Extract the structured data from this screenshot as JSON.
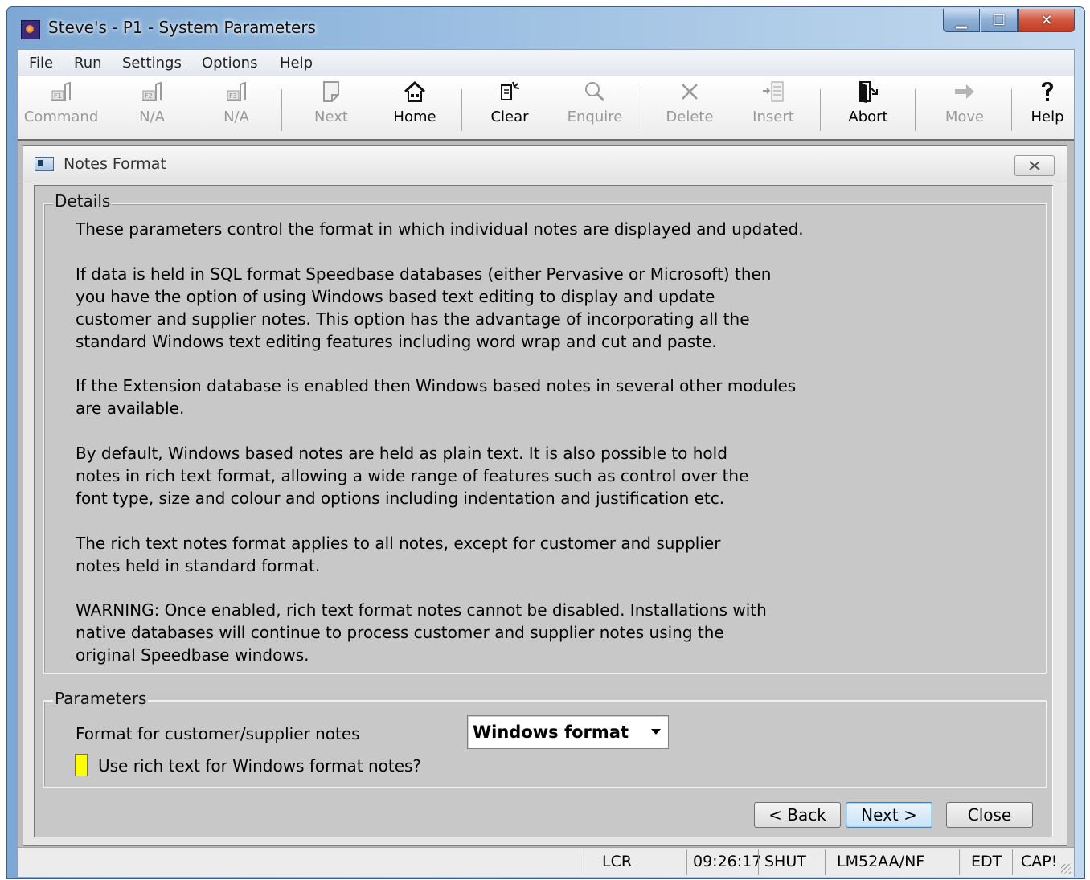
{
  "window": {
    "title": "Steve's - P1 - System Parameters",
    "controls": {
      "minimize": "▁",
      "maximize": "☐",
      "close": "✕"
    }
  },
  "menu": [
    "File",
    "Run",
    "Settings",
    "Options",
    "Help"
  ],
  "toolbar": {
    "command": "Command",
    "f2": "N/A",
    "f3": "N/A",
    "next": "Next",
    "home": "Home",
    "clear": "Clear",
    "enquire": "Enquire",
    "delete": "Delete",
    "insert": "Insert",
    "abort": "Abort",
    "move": "Move",
    "help": "Help",
    "f1_key": "F1",
    "f2_key": "F2",
    "f3_key": "F3"
  },
  "dialog": {
    "title": "Notes Format",
    "details": {
      "legend": "Details",
      "lines": [
        "These parameters control the format in which individual notes are displayed and updated.",
        "If data is held in SQL format Speedbase databases (either Pervasive or Microsoft) then",
        "you have the option of using Windows based text editing to display and update",
        "customer and supplier notes. This option has the advantage of incorporating all the",
        "standard Windows text editing features including word wrap and cut and paste.",
        "If the Extension database is enabled then Windows based notes in several other modules",
        "are available.",
        "By default, Windows based notes are held as plain text. It is also possible to hold",
        "notes in rich text format, allowing a wide range of features such as control over the",
        "font type, size and colour and options including indentation and justification etc.",
        "The rich text notes format applies to all notes, except for customer and supplier",
        "notes held in standard format.",
        "WARNING: Once enabled, rich text format notes cannot be disabled. Installations with",
        "native databases will continue to process customer and supplier notes using the",
        "original Speedbase windows."
      ]
    },
    "parameters": {
      "legend": "Parameters",
      "format_label": "Format for customer/supplier notes",
      "format_value": "Windows format",
      "rich_text_label": "Use rich text for Windows format notes?",
      "rich_text_checked": false
    },
    "buttons": {
      "back": "< Back",
      "next": "Next >",
      "close": "Close"
    }
  },
  "status_bar": {
    "lcr": "LCR",
    "time": "09:26:17",
    "mode": "SHUT",
    "company": "LM52AA/NF",
    "edt": "EDT",
    "caps": "CAP!"
  },
  "colors": {
    "checkbox_fill": "#ffff00",
    "default_button": "#c8e3f7"
  }
}
